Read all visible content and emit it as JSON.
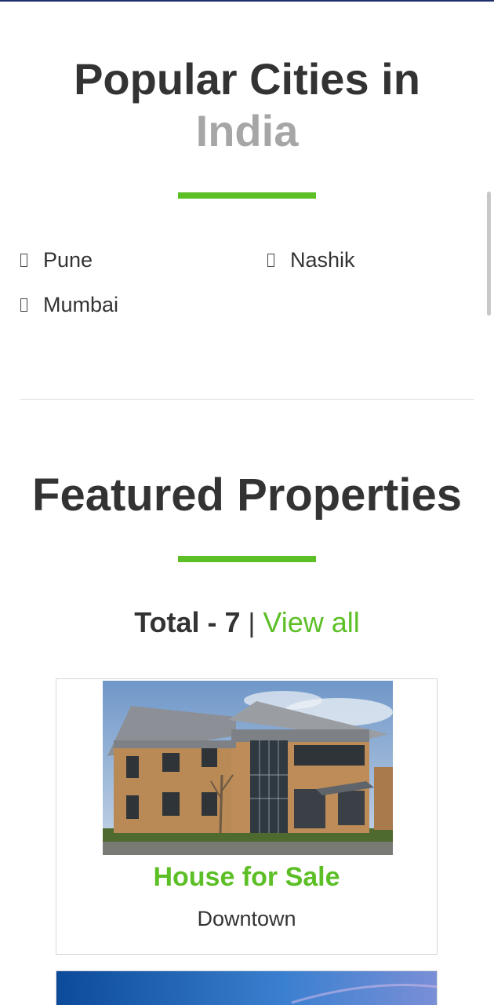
{
  "cities_section": {
    "title_line1": "Popular Cities in",
    "title_line2": "India",
    "cities": [
      {
        "name": "Pune"
      },
      {
        "name": "Nashik"
      },
      {
        "name": "Mumbai"
      }
    ]
  },
  "featured_section": {
    "title": "Featured Properties",
    "total_label": "Total - 7",
    "separator": "|",
    "view_all_label": "View all"
  },
  "properties": [
    {
      "title": "House for Sale",
      "location": "Downtown",
      "image": "office-building-photo"
    },
    {
      "image": "blue-sky-photo"
    }
  ],
  "colors": {
    "accent": "#5cbf26",
    "heading": "#333333",
    "muted": "#a6a6a6",
    "top_rule": "#1c2f6b"
  }
}
